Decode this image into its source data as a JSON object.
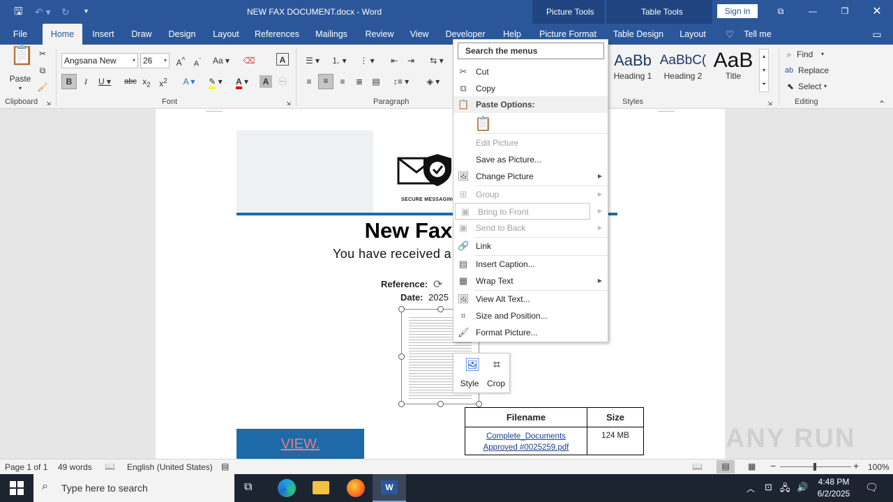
{
  "title_bar": {
    "doc_title": "NEW FAX DOCUMENT.docx  -  Word",
    "picture_tools": "Picture Tools",
    "table_tools": "Table Tools",
    "sign_in": "Sign in"
  },
  "tabs": [
    "File",
    "Home",
    "Insert",
    "Draw",
    "Design",
    "Layout",
    "References",
    "Mailings",
    "Review",
    "View",
    "Developer",
    "Help",
    "Picture Format",
    "Table Design",
    "Layout"
  ],
  "tell_me": "Tell me",
  "ribbon": {
    "paste_label": "Paste",
    "font_name": "Angsana New",
    "font_size": "26",
    "groups": {
      "clipboard": "Clipboard",
      "font": "Font",
      "paragraph": "Paragraph",
      "styles": "Styles",
      "editing": "Editing"
    },
    "styles": [
      {
        "sample": "AaBb",
        "name": "Heading 1"
      },
      {
        "sample": "AaBbC(",
        "name": "Heading 2"
      },
      {
        "sample": "AaB",
        "name": "Title"
      }
    ],
    "editing": {
      "find": "Find",
      "replace": "Replace",
      "select": "Select"
    }
  },
  "document": {
    "logo_caption": "SECURE MESSAGING",
    "heading": "New Fax D",
    "subheading": "You have received a",
    "reference_label": "Reference:",
    "date_label": "Date:",
    "date_value": "2025",
    "view_button": "VIEW.",
    "table": {
      "headers": [
        "Filename",
        "Size"
      ],
      "rows": [
        [
          "Complete_Documents Approved #0025259.pdf",
          "124 MB"
        ]
      ]
    }
  },
  "context_menu": {
    "search_placeholder": "Search the menus",
    "items": {
      "cut": "Cut",
      "copy": "Copy",
      "paste_options": "Paste Options:",
      "edit_picture": "Edit Picture",
      "save_as_picture": "Save as Picture...",
      "change_picture": "Change Picture",
      "group": "Group",
      "bring_to_front": "Bring to Front",
      "send_to_back": "Send to Back",
      "link": "Link",
      "insert_caption": "Insert Caption...",
      "wrap_text": "Wrap Text",
      "view_alt_text": "View Alt Text...",
      "size_and_position": "Size and Position...",
      "format_picture": "Format Picture..."
    }
  },
  "mini_toolbar": {
    "style": "Style",
    "crop": "Crop"
  },
  "status_bar": {
    "page": "Page 1 of 1",
    "words": "49 words",
    "language": "English (United States)",
    "zoom": "100%"
  },
  "taskbar": {
    "search_placeholder": "Type here to search",
    "time": "4:48 PM",
    "date": "6/2/2025"
  },
  "watermark": "ANY RUN",
  "colors": {
    "word_blue": "#2b579a",
    "context_blue": "#1f4480",
    "link": "#1a3c8f",
    "banner": "#1e6aa8"
  }
}
